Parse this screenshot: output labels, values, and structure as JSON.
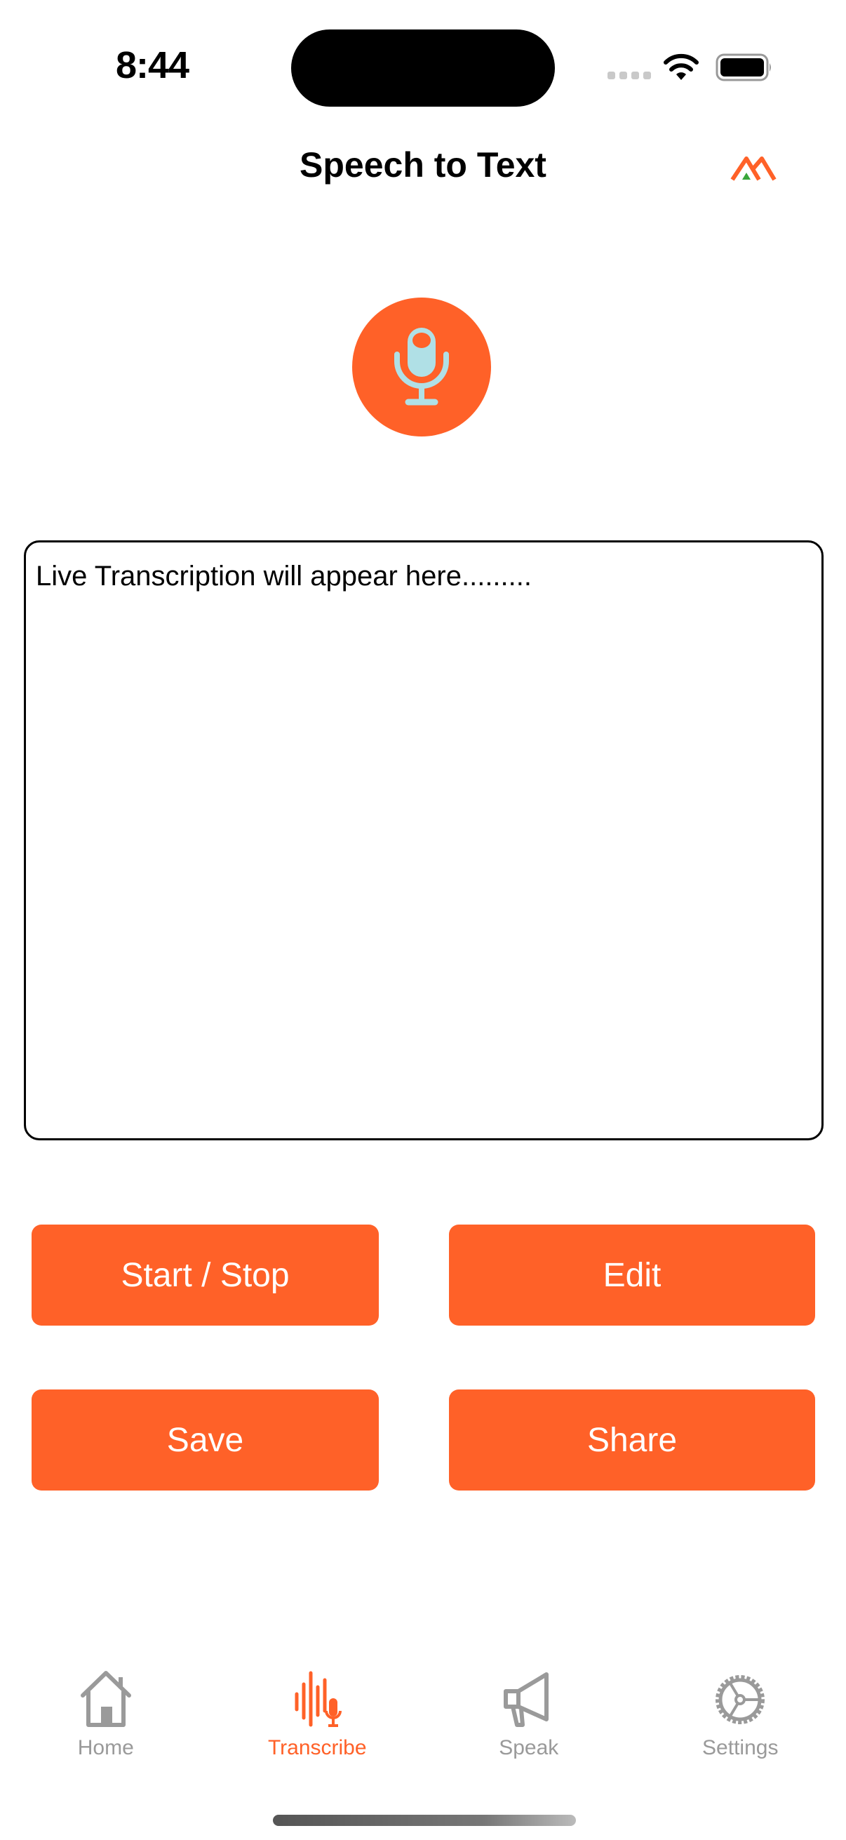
{
  "status_bar": {
    "time": "8:44"
  },
  "nav": {
    "title": "Speech to Text",
    "logo_icon": "brand-mountains-logo"
  },
  "mic": {
    "icon": "microphone-icon",
    "color": "#ff6128",
    "icon_color": "#b0e0e6"
  },
  "transcript": {
    "placeholder": "Live Transcription will appear here........."
  },
  "buttons": {
    "start_stop": "Start / Stop",
    "edit": "Edit",
    "save": "Save",
    "share": "Share"
  },
  "tabs": [
    {
      "label": "Home",
      "icon": "house-icon",
      "active": false
    },
    {
      "label": "Transcribe",
      "icon": "waveform-mic-icon",
      "active": true
    },
    {
      "label": "Speak",
      "icon": "megaphone-icon",
      "active": false
    },
    {
      "label": "Settings",
      "icon": "gear-icon",
      "active": false
    }
  ],
  "colors": {
    "accent": "#ff6128",
    "inactive": "#9a9a9a",
    "logo_green": "#3aa63a"
  }
}
